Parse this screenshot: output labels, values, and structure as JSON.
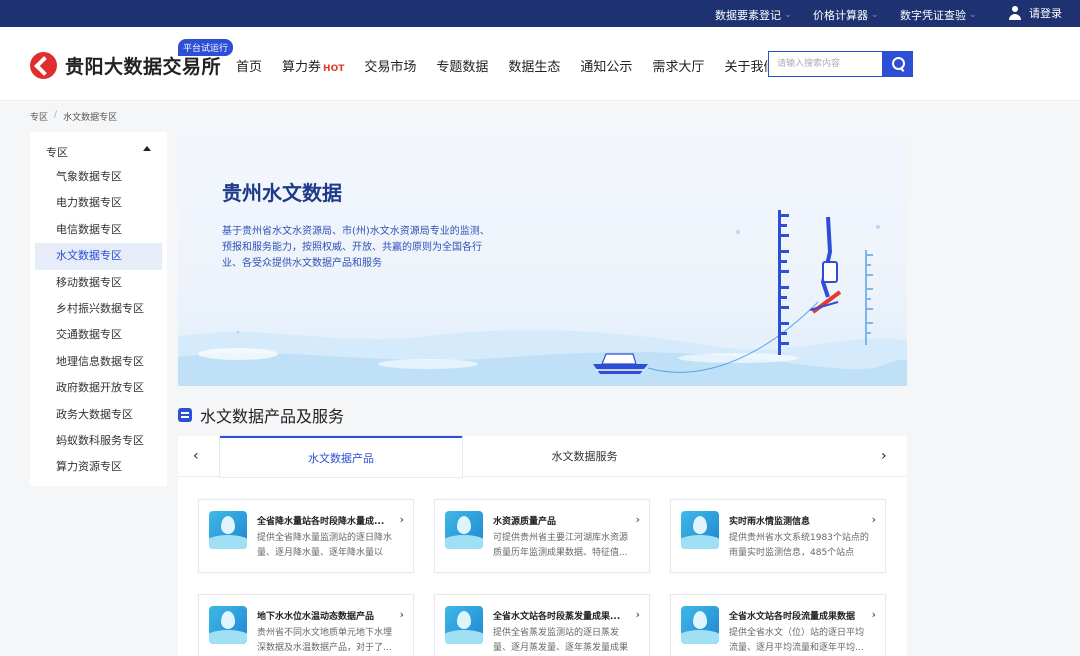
{
  "topbar": {
    "items": [
      {
        "label": "数据要素登记"
      },
      {
        "label": "价格计算器"
      },
      {
        "label": "数字凭证查验"
      }
    ],
    "login_label": "请登录"
  },
  "header": {
    "logo_text": "贵阳大数据交易所",
    "trial_badge": "平台试运行",
    "nav": [
      {
        "label": "首页"
      },
      {
        "label": "算力券",
        "hot": "HOT"
      },
      {
        "label": "交易市场"
      },
      {
        "label": "专题数据"
      },
      {
        "label": "数据生态"
      },
      {
        "label": "通知公示"
      },
      {
        "label": "需求大厅"
      },
      {
        "label": "关于我们"
      }
    ],
    "search_placeholder": "请输入搜索内容"
  },
  "breadcrumb": {
    "root": "专区",
    "separator": "/",
    "current": "水文数据专区"
  },
  "sidebar": {
    "heading": "专区",
    "items": [
      {
        "label": "气象数据专区"
      },
      {
        "label": "电力数据专区"
      },
      {
        "label": "电信数据专区"
      },
      {
        "label": "水文数据专区",
        "active": true
      },
      {
        "label": "移动数据专区"
      },
      {
        "label": "乡村振兴数据专区"
      },
      {
        "label": "交通数据专区"
      },
      {
        "label": "地理信息数据专区"
      },
      {
        "label": "政府数据开放专区"
      },
      {
        "label": "政务大数据专区"
      },
      {
        "label": "蚂蚁数科服务专区"
      },
      {
        "label": "算力资源专区"
      }
    ]
  },
  "banner": {
    "title": "贵州水文数据",
    "description": "基于贵州省水文水资源局、市(州)水文水资源局专业的监测、预报和服务能力，按照权威、开放、共赢的原则为全国各行业、各受众提供水文数据产品和服务"
  },
  "section": {
    "title": "水文数据产品及服务"
  },
  "tabs": [
    {
      "label": "水文数据产品",
      "active": true
    },
    {
      "label": "水文数据服务"
    }
  ],
  "cards": [
    {
      "title": "全省降水量站各时段降水量成...",
      "desc": "提供全省降水量监测站的逐日降水量、逐月降水量、逐年降水量以及..."
    },
    {
      "title": "水资源质量产品",
      "desc": "可提供贵州省主要江河湖库水资源质量历年监测成果数据、特征值..."
    },
    {
      "title": "实时雨水情监测信息",
      "desc": "提供贵州省水文系统1983个站点的雨量实时监测信息，485个站点的..."
    },
    {
      "title": "地下水水位水温动态数据产品",
      "desc": "贵州省不同水文地质单元地下水埋深数据及水温数据产品，对于了..."
    },
    {
      "title": "全省水文站各时段蒸发量成果...",
      "desc": "提供全省蒸发监测站的逐日蒸发量、逐月蒸发量、逐年蒸发量成果"
    },
    {
      "title": "全省水文站各时段流量成果数据",
      "desc": "提供全省水文（位）站的逐日平均流量、逐月平均流量和逐年平均..."
    }
  ],
  "colors": {
    "primary": "#2d4fd6",
    "topbar": "#1e3170",
    "hot": "#e23b2e"
  }
}
